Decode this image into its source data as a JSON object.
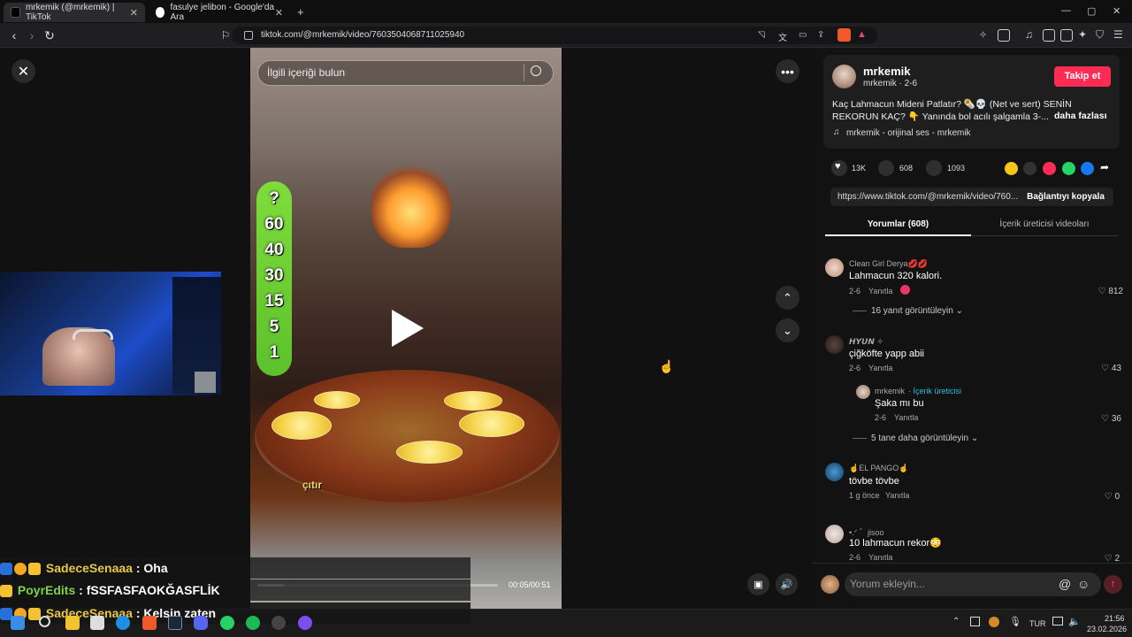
{
  "browser": {
    "tabs": [
      {
        "title": "mrkemik (@mrkemik) | TikTok",
        "active": true
      },
      {
        "title": "fasulye jelibon - Google'da Ara",
        "active": false
      }
    ],
    "url": "tiktok.com/@mrkemik/video/7603504068711025940",
    "new_tab": "+",
    "window_controls": [
      "—",
      "▢",
      "✕"
    ]
  },
  "video": {
    "search_placeholder": "İlgili içeriği bulun",
    "countdown": [
      "?",
      "60",
      "40",
      "30",
      "15",
      "5",
      "1"
    ],
    "caption": "çıtır",
    "time": "00:05/00:51",
    "progress": 0.11
  },
  "post": {
    "username": "mrkemik",
    "handle_date": "mrkemik · 2-6",
    "follow_label": "Takip et",
    "description_line1": "Kaç Lahmacun Mideni Patlatır? 🌯💀 (Net ve sert) SENİN",
    "description_line2": "REKORUN KAÇ? 👇 Yanında bol acılı şalgamla 3-...",
    "more_label": "daha fazlası",
    "sound": "mrkemik - orijinal ses - mrkemik",
    "likes": "13K",
    "comments": "608",
    "saves": "1093",
    "link": "https://www.tiktok.com/@mrkemik/video/760...",
    "copy_label": "Bağlantıyı kopyala",
    "tab_comments": "Yorumlar (608)",
    "tab_creator": "İçerik üreticisi videoları"
  },
  "comments": [
    {
      "name": "Clean Girl Derya💋💋",
      "text": "Lahmacun 320 kalori.",
      "date": "2-6",
      "reply": "Yanıtla",
      "likes": "812",
      "view_replies": "16 yanıt görüntüleyin"
    },
    {
      "name": "𝙃𝙔𝙐𝙉 ✧",
      "text": "çiğköfte yapp abii",
      "date": "2-6",
      "reply": "Yanıtla",
      "likes": "43"
    },
    {
      "name": "mrkemik",
      "creator_tag": "· İçerik üreticisi",
      "text": "Şaka mı bu",
      "date": "2-6",
      "reply": "Yanıtla",
      "likes": "36",
      "view_more": "5 tane daha görüntüleyin"
    },
    {
      "name": "☝️EL PANGO☝️",
      "text": "tövbe tövbe",
      "date": "1 g önce",
      "reply": "Yanıtla",
      "likes": "0"
    },
    {
      "name": "•.ᐟ ゛jisoo",
      "text": "10 lahmacun rekor😳",
      "date": "2-6",
      "reply": "Yanıtla",
      "likes": "2"
    }
  ],
  "comment_input_placeholder": "Yorum ekleyin...",
  "chat": [
    {
      "user": "SadeceSenaaa",
      "message": " : Oha",
      "color": "#e6c84a"
    },
    {
      "user": "PoyrEdits",
      "message": " : fSSFASFAOKĞASFLİK",
      "color": "#7cd44a"
    },
    {
      "user": "SadeceSenaaa",
      "message": " : Kelsin zaten",
      "color": "#e6c84a"
    }
  ],
  "taskbar": {
    "lang": "TUR",
    "time": "21:56",
    "date": "23.02.2026"
  }
}
